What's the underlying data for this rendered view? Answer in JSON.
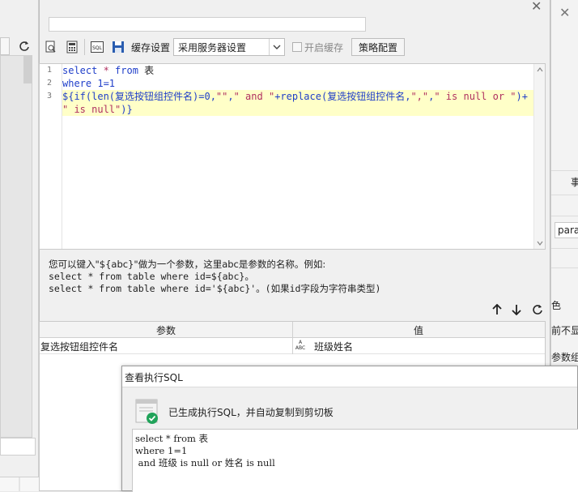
{
  "editor": {
    "line_numbers": [
      "1",
      "2",
      "3"
    ],
    "line1": {
      "kw1": "select",
      "mid": " * ",
      "kw2": "from",
      "tail": " 表"
    },
    "line2": {
      "kw1": "where",
      "tail": " 1=1"
    },
    "line3a": {
      "p1": "${if(len(复选按钮组控件名)=0,",
      "s1": "\"\"",
      "p2": ",",
      "s2": "\" and \"",
      "p3": "+replace(复选按钮组控件名,",
      "s3": "\",\"",
      "p4": ",",
      "s4": "\" is null or \"",
      "p5": ")+"
    },
    "line3b": {
      "s1": "\" is null\"",
      "p1": ")}"
    }
  },
  "toolbar": {
    "cache_label": "缓存设置",
    "cache_select_value": "采用服务器设置",
    "cache_checkbox_label": "开启缓存",
    "strategy_button": "策略配置",
    "icons": [
      "preview-icon",
      "calculator-icon",
      "sql-icon",
      "save-icon"
    ]
  },
  "hint": {
    "line1": "您可以键入\"${abc}\"做为一个参数，这里abc是参数的名称。例如:",
    "line2": "select * from table where id=${abc}。",
    "line3": "select * from table where id='${abc}'。(如果id字段为字符串类型)"
  },
  "param_table": {
    "col_param": "参数",
    "col_value": "值",
    "row_param": "复选按钮组控件名",
    "row_type_icon_text": "ABC",
    "row_value": "班级姓名"
  },
  "right_panel": {
    "text1": "事",
    "input_text": "para",
    "text2": "色",
    "text3": "前不显",
    "text4": "参数组"
  },
  "popup": {
    "title": "查看执行SQL",
    "message": "已生成执行SQL，并自动复制到剪切板",
    "sql_lines": [
      "select * from 表",
      "where 1=1",
      " and 班级 is null or 姓名 is null"
    ]
  },
  "colors": {
    "highlight": "#ffffc8",
    "keyword": "#1f3ec9",
    "string": "#b03060",
    "success": "#21a35a"
  }
}
